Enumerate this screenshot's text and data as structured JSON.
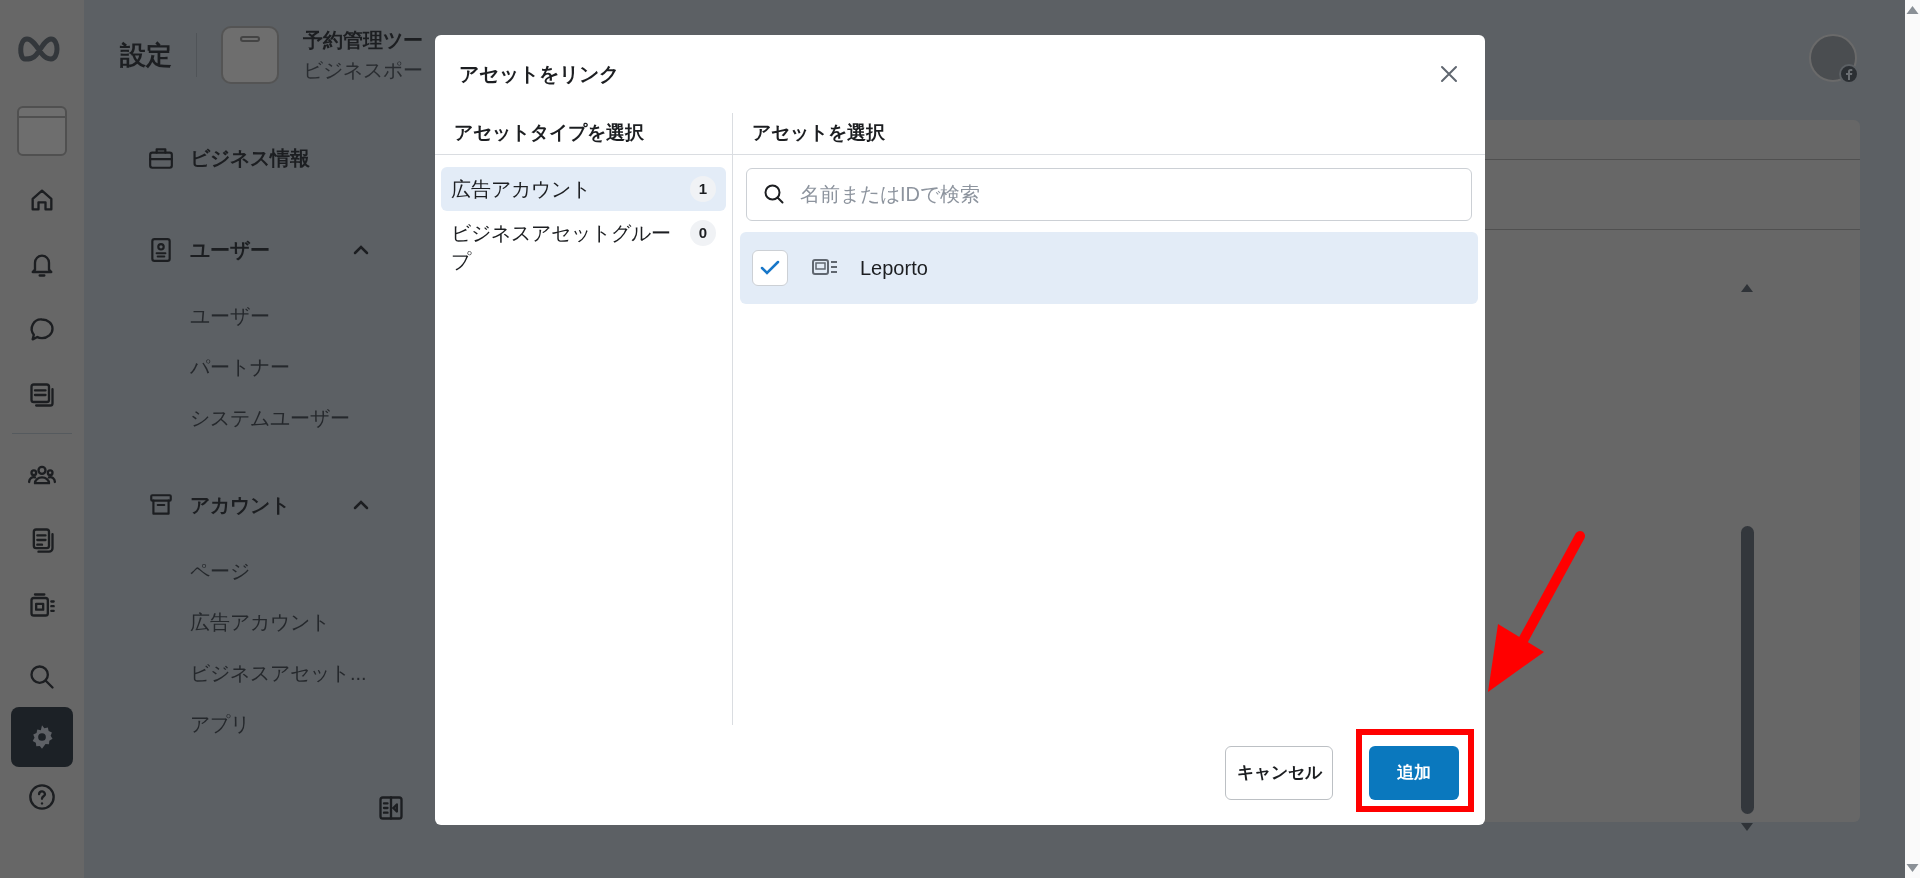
{
  "rail": {
    "items": [
      {
        "kind": "home",
        "selected": false
      },
      {
        "kind": "bell",
        "selected": false
      },
      {
        "kind": "chat",
        "selected": false
      },
      {
        "kind": "pages",
        "selected": false
      },
      {
        "kind": "people",
        "selected": false
      },
      {
        "kind": "docs",
        "selected": false
      },
      {
        "kind": "catalog",
        "selected": false
      },
      {
        "kind": "search",
        "selected": false
      },
      {
        "kind": "settings",
        "selected": true
      },
      {
        "kind": "help",
        "selected": false
      }
    ]
  },
  "header": {
    "title": "設定",
    "business_name": "予約管理ツー",
    "business_subtitle": "ビジネスポー"
  },
  "sidebar": {
    "link": {
      "label": "ビジネス情報"
    },
    "groups": [
      {
        "label": "ユーザー",
        "kind": "user",
        "expanded": true,
        "children": [
          {
            "label": "ユーザー"
          },
          {
            "label": "パートナー"
          },
          {
            "label": "システムユーザー"
          }
        ]
      },
      {
        "label": "アカウント",
        "kind": "archive",
        "expanded": true,
        "children": [
          {
            "label": "ページ"
          },
          {
            "label": "広告アカウント"
          },
          {
            "label": "ビジネスアセット..."
          },
          {
            "label": "アプリ"
          }
        ]
      }
    ]
  },
  "dialog": {
    "title": "アセットをリンク",
    "left_header": "アセットタイプを選択",
    "right_header": "アセットを選択",
    "asset_types": [
      {
        "label": "広告アカウント",
        "count": "1",
        "selected": true
      },
      {
        "label": "ビジネスアセットグループ",
        "count": "0",
        "selected": false
      }
    ],
    "search": {
      "placeholder": "名前またはIDで検索"
    },
    "assets": [
      {
        "name": "Leporto",
        "checked": true,
        "selected": true
      }
    ],
    "buttons": {
      "cancel": "キャンセル",
      "add": "追加"
    }
  }
}
